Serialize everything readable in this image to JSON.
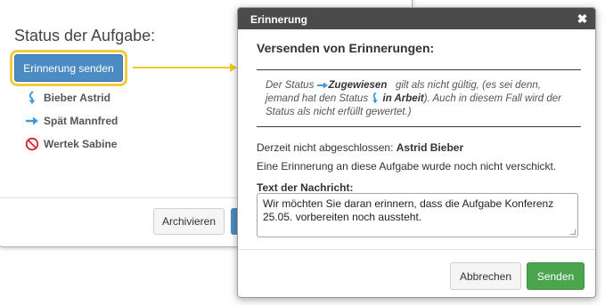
{
  "background": {
    "status_title": "Status der Aufgabe:",
    "remind_button": "Erinnerung senden",
    "people": [
      {
        "name": "Bieber Astrid",
        "icon": "down-arrow-icon"
      },
      {
        "name": "Spät Mannfred",
        "icon": "right-arrow-icon"
      },
      {
        "name": "Wertek Sabine",
        "icon": "prohibited-icon"
      }
    ],
    "archive_button": "Archivieren"
  },
  "modal": {
    "title": "Erinnerung",
    "close_label": "✖",
    "section_title": "Versenden von Erinnerungen:",
    "note": {
      "part1": "Der Status",
      "status1": "Zugewiesen",
      "part2": "gilt als nicht gültig, (es sei denn, jemand hat den Status",
      "status2": "in Arbeit",
      "part3": "). Auch in diesem Fall wird der Status als nicht erfüllt gewertet.)"
    },
    "open_label": "Derzeit nicht abgeschlossen:",
    "open_name": "Astrid Bieber",
    "not_sent": "Eine Erinnerung an diese Aufgabe wurde noch nicht verschickt.",
    "message_label": "Text der Nachricht:",
    "message_text": "Wir möchten Sie daran erinnern, dass die Aufgabe Konferenz 25.05. vorbereiten noch aussteht.",
    "cancel_button": "Abbrechen",
    "send_button": "Senden"
  },
  "colors": {
    "primary": "#4d8bc3",
    "highlight": "#f0cc3a",
    "success": "#4aa54d",
    "header": "#4b4b4b",
    "icon_blue": "#3f9ae0",
    "icon_red": "#d9252a"
  }
}
